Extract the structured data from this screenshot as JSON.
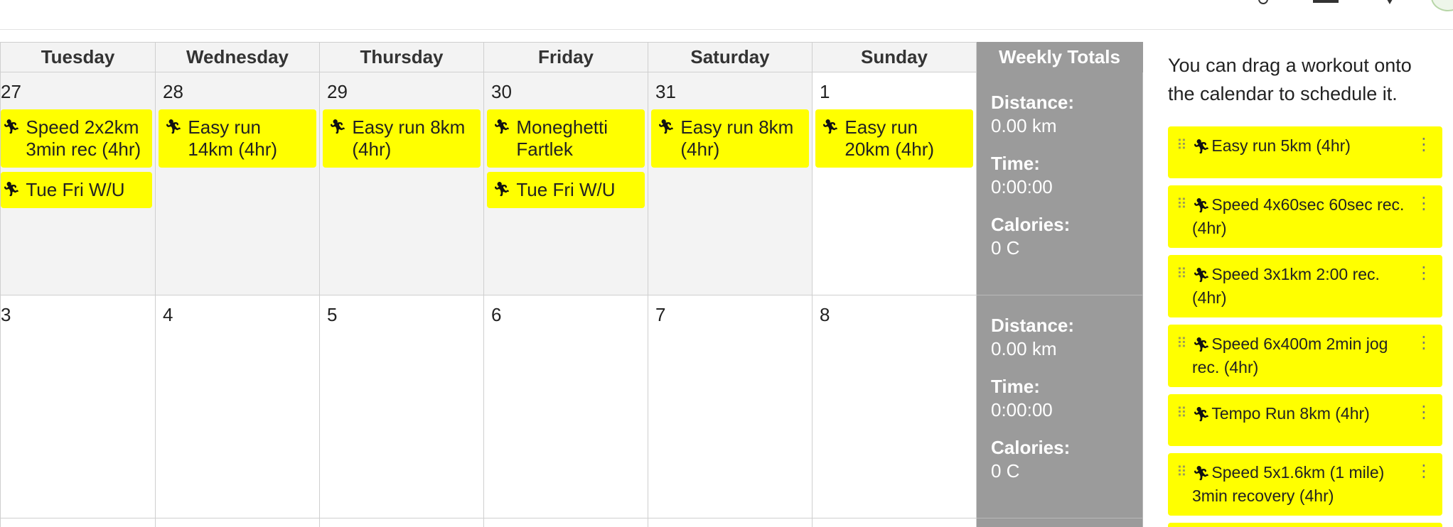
{
  "calendar": {
    "headers": [
      "Tuesday",
      "Wednesday",
      "Thursday",
      "Friday",
      "Saturday",
      "Sunday",
      "Weekly Totals"
    ],
    "weeks": [
      {
        "days": [
          {
            "num": "27",
            "workouts": [
              "Speed 2x2km 3min rec (4hr)",
              "Tue Fri W/U"
            ]
          },
          {
            "num": "28",
            "workouts": [
              "Easy run 14km (4hr)"
            ]
          },
          {
            "num": "29",
            "workouts": [
              "Easy run 8km (4hr)"
            ]
          },
          {
            "num": "30",
            "workouts": [
              "Moneghetti Fartlek",
              "Tue Fri W/U"
            ]
          },
          {
            "num": "31",
            "workouts": [
              "Easy run 8km (4hr)"
            ]
          },
          {
            "num": "1",
            "workouts": [
              "Easy run 20km (4hr)"
            ]
          }
        ],
        "totals": {
          "distance_label": "Distance:",
          "distance": "0.00 km",
          "time_label": "Time:",
          "time": "0:00:00",
          "calories_label": "Calories:",
          "calories": "0 C"
        }
      },
      {
        "days": [
          {
            "num": "3",
            "workouts": []
          },
          {
            "num": "4",
            "workouts": []
          },
          {
            "num": "5",
            "workouts": []
          },
          {
            "num": "6",
            "workouts": []
          },
          {
            "num": "7",
            "workouts": []
          },
          {
            "num": "8",
            "workouts": []
          }
        ],
        "totals": {
          "distance_label": "Distance:",
          "distance": "0.00 km",
          "time_label": "Time:",
          "time": "0:00:00",
          "calories_label": "Calories:",
          "calories": "0 C"
        }
      }
    ]
  },
  "panel": {
    "hint": "You can drag a workout onto the calendar to schedule it.",
    "library": [
      "Easy run 5km (4hr)",
      "Speed 4x60sec 60sec rec. (4hr)",
      "Speed 3x1km 2:00 rec. (4hr)",
      "Speed 6x400m 2min jog rec. (4hr)",
      "Tempo Run 8km (4hr)",
      "Speed 5x1.6km (1 mile) 3min recovery (4hr)"
    ]
  },
  "icons": {
    "workout": "running-person-icon",
    "drag": "drag-handle-icon",
    "menu": "kebab-menu-icon"
  },
  "colors": {
    "workout_bg": "#ffff00",
    "totals_bg": "#9b9b9b",
    "past_day_bg": "#f3f3f3",
    "header_bg": "#f3f3f3"
  }
}
